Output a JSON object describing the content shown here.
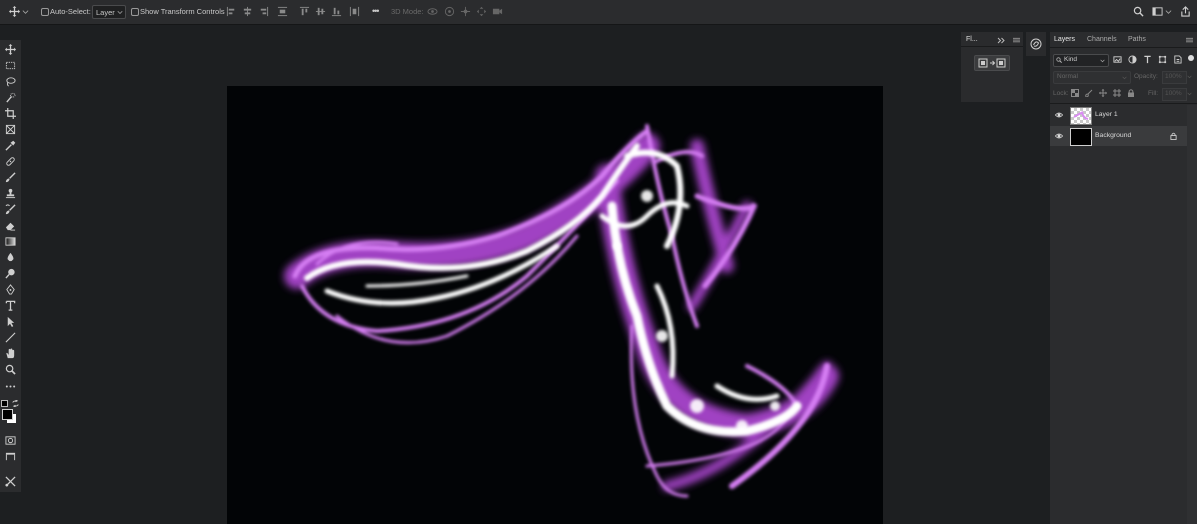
{
  "options_bar": {
    "auto_select_label": "Auto-Select:",
    "auto_select_value": "Layer",
    "show_transform_label": "Show Transform Controls",
    "more_label": "•••",
    "mode_3d_label": "3D Mode:"
  },
  "mini_panel": {
    "title": "Fl..."
  },
  "layers_panel": {
    "tabs": [
      "Layers",
      "Channels",
      "Paths"
    ],
    "filter_label": "Kind",
    "blend_mode": "Normal",
    "opacity_label": "Opacity:",
    "opacity_value": "100%",
    "lock_label": "Lock:",
    "fill_label": "Fill:",
    "fill_value": "100%",
    "layers": [
      {
        "name": "Layer 1"
      },
      {
        "name": "Background"
      }
    ]
  },
  "colors": {
    "accent_glow": "#d98cf2",
    "canvas_bg": "#020406",
    "ui_panel": "#2b2c2e"
  }
}
